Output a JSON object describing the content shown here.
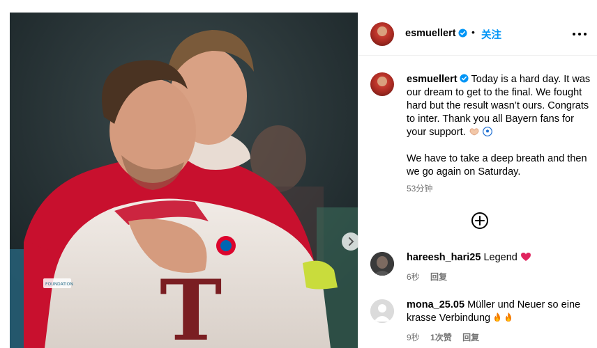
{
  "post": {
    "username": "esmuellert",
    "separator": "•",
    "follow_label": "关注",
    "caption_p1": "Today is a hard day. It was our dream to get to the final. We fought hard but the result wasn’t ours. Congrats to inter. Thank you all Bayern fans for your support.",
    "caption_p2": "We have to take a deep breath and then we go again on Saturday.",
    "timestamp": "53分钟"
  },
  "photo": {
    "jersey_letter": "T",
    "sponsor_text": "FOUNDATION"
  },
  "comments": [
    {
      "username": "hareesh_hari25",
      "text": "Legend",
      "time": "6秒",
      "reply_label": "回复"
    },
    {
      "username": "mona_25.05",
      "text": "Müller und Neuer so eine krasse Verbindung",
      "time": "9秒",
      "likes": "1次赞",
      "reply_label": "回复"
    }
  ],
  "icons": {
    "verified": "verified-badge-icon",
    "more": "more-options-icon",
    "load_more": "plus-circle-icon",
    "next": "chevron-right-icon"
  },
  "colors": {
    "accent": "#0095f6",
    "muted": "#737373",
    "jersey_red": "#c8102e"
  }
}
